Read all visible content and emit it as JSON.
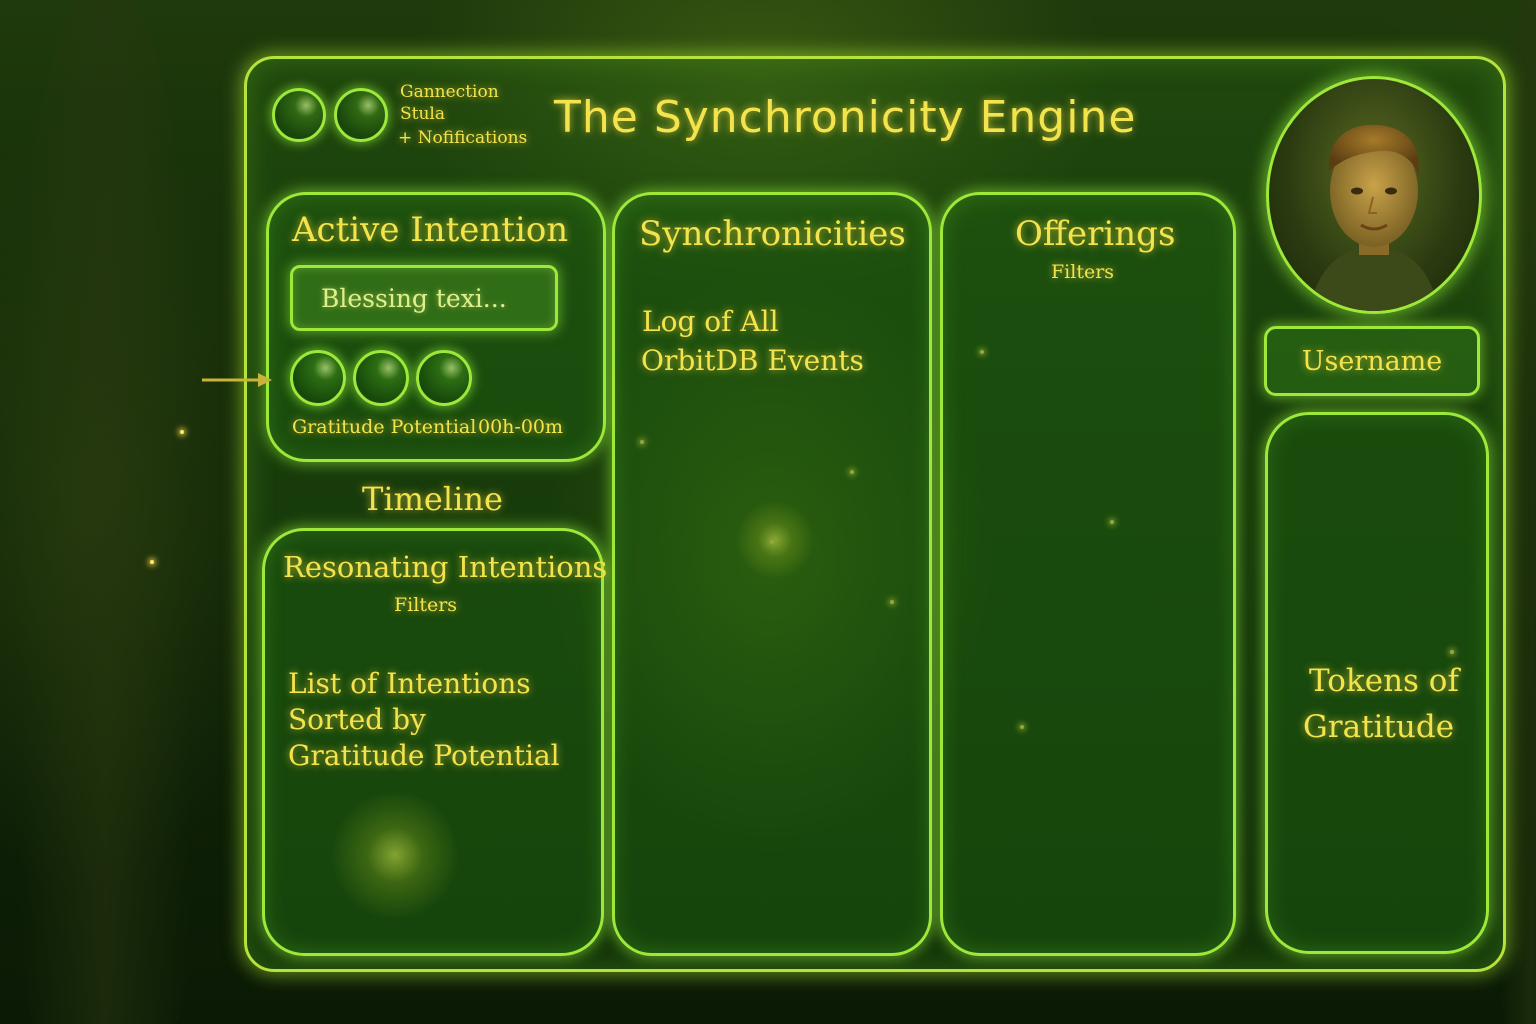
{
  "header": {
    "title": "The Synchronicity Engine",
    "status_lines": [
      "Gannection",
      "Stula",
      "+ Nofifications"
    ]
  },
  "active_intention": {
    "heading": "Active Intention",
    "input_value": "Blessing texi...",
    "gratitude_label": "Gratitude Potential",
    "timer": "00h-00m"
  },
  "timeline": {
    "heading": "Timeline"
  },
  "resonating": {
    "heading": "Resonating Intentions",
    "filters_label": "Filters",
    "body_lines": [
      "List of Intentions",
      "Sorted by",
      "Gratitude Potential"
    ]
  },
  "synchronicities": {
    "heading": "Synchronicities",
    "body_lines": [
      "Log of All",
      "OrbitDB Events"
    ]
  },
  "offerings": {
    "heading": "Offerings",
    "filters_label": "Filters"
  },
  "profile": {
    "username": "Username"
  },
  "tokens": {
    "body_lines": [
      "Tokens of",
      "Gratitude"
    ]
  },
  "colors": {
    "panel_border": "#9ee83a",
    "text_gold": "#f3e34c",
    "background": "#132a08"
  }
}
